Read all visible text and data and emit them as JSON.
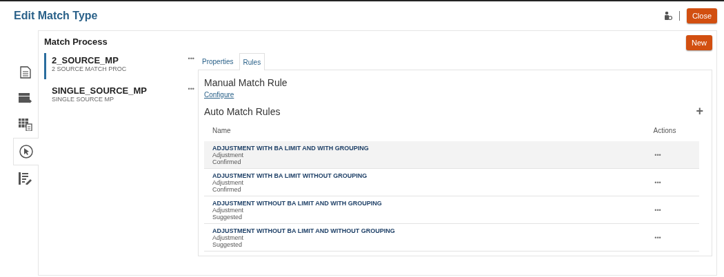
{
  "header": {
    "title": "Edit Match Type",
    "close_button": "Close"
  },
  "rail": [
    {
      "kind": "document",
      "selected": false
    },
    {
      "kind": "transfer",
      "selected": false
    },
    {
      "kind": "grid",
      "selected": false
    },
    {
      "kind": "cursor",
      "selected": true
    },
    {
      "kind": "edit",
      "selected": false
    }
  ],
  "match_process": {
    "title": "Match Process",
    "new_button": "New",
    "items": [
      {
        "name": "2_SOURCE_MP",
        "description": "2 SOURCE MATCH PROC",
        "actions": "•••",
        "selected": true
      },
      {
        "name": "SINGLE_SOURCE_MP",
        "description": "SINGLE SOURCE MP",
        "actions": "•••",
        "selected": false
      }
    ]
  },
  "tabs": [
    {
      "label": "Properties",
      "selected": false
    },
    {
      "label": "Rules",
      "selected": true
    }
  ],
  "manual_match_rule": {
    "title": "Manual Match Rule",
    "link": "Configure"
  },
  "auto_match_rules": {
    "title": "Auto Match Rules",
    "add_button": "+",
    "columns": [
      "Name",
      "Actions"
    ],
    "rows": [
      {
        "name": "ADJUSTMENT WITH BA LIMIT AND WITH GROUPING",
        "type": "Adjustment",
        "status": "Confirmed",
        "actions": "•••",
        "selected": true
      },
      {
        "name": "ADJUSTMENT WITH BA LIMIT WITHOUT GROUPING",
        "type": "Adjustment",
        "status": "Confirmed",
        "actions": "•••",
        "selected": false
      },
      {
        "name": "ADJUSTMENT WITHOUT BA LIMIT AND WITH GROUPING",
        "type": "Adjustment",
        "status": "Suggested",
        "actions": "•••",
        "selected": false
      },
      {
        "name": "ADJUSTMENT WITHOUT BA LIMIT AND WITHOUT GROUPING",
        "type": "Adjustment",
        "status": "Suggested",
        "actions": "•••",
        "selected": false
      }
    ]
  }
}
